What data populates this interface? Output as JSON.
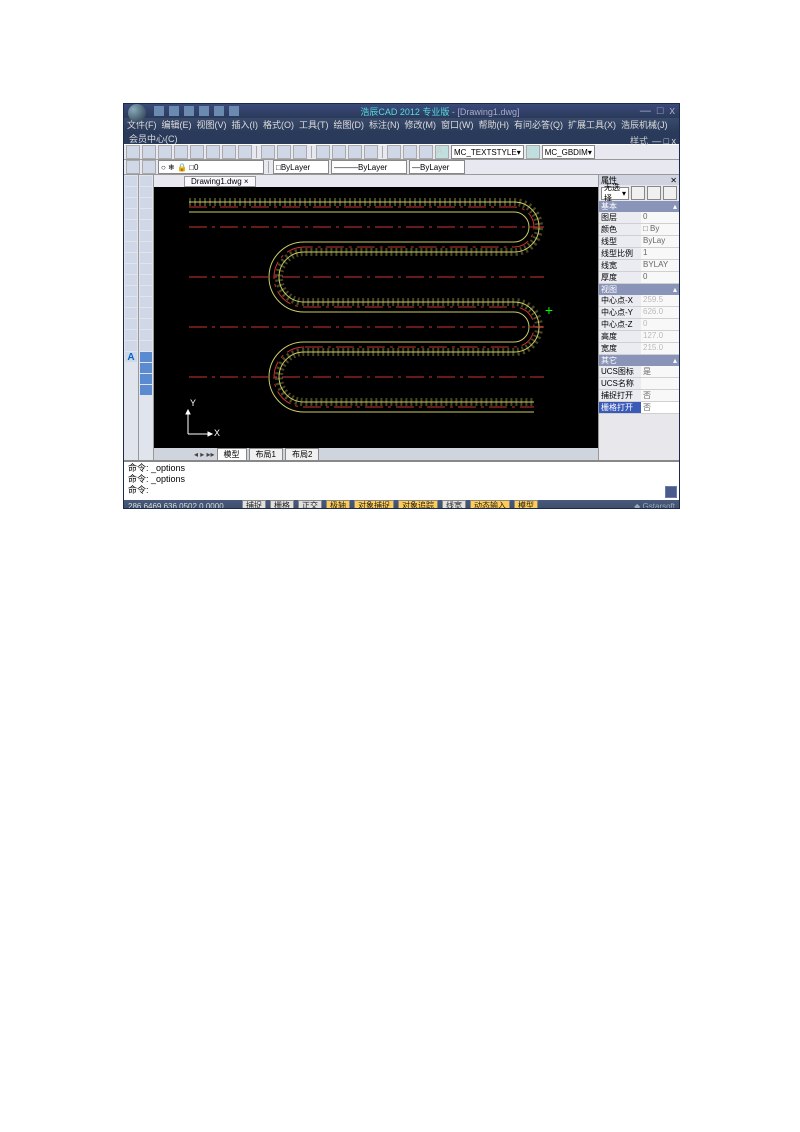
{
  "title": {
    "app": "浩辰CAD 2012 专业版",
    "doc": "[Drawing1.dwg]"
  },
  "win": {
    "min": "—",
    "max": "□",
    "close": "x"
  },
  "menus": [
    "文件(F)",
    "编辑(E)",
    "视图(V)",
    "插入(I)",
    "格式(O)",
    "工具(T)",
    "绘图(D)",
    "标注(N)",
    "修改(M)",
    "窗口(W)",
    "帮助(H)",
    "有问必答(Q)",
    "扩展工具(X)",
    "浩辰机械(J)"
  ],
  "menus2": {
    "member": "会员中心(C)",
    "style": "样式",
    "sub": "— □ x"
  },
  "styles": {
    "text": "MC_TEXTSTYLE",
    "dim": "MC_GBDIM"
  },
  "layer": {
    "name": "0",
    "color1": "ByLayer",
    "color2": "ByLayer",
    "color3": "ByLayer"
  },
  "doctab": "Drawing1.dwg ×",
  "viewtabs": {
    "model": "模型",
    "l1": "布局1",
    "l2": "布局2"
  },
  "cmd": {
    "l1": "命令: _options",
    "l2": "命令: _options",
    "l3": "命令:"
  },
  "status": {
    "coord": "286.6469,636.0502,0.0000",
    "btns": [
      "捕捉",
      "栅格",
      "正交",
      "极轴",
      "对象捕捉",
      "对象追踪",
      "线宽",
      "动态输入",
      "模型"
    ],
    "brand": "Gstarsoft"
  },
  "props": {
    "title": "属性",
    "sel": "无选择",
    "cats": {
      "basic": "基本",
      "view": "视图",
      "misc": "其它"
    },
    "rows": {
      "layer": {
        "l": "图层",
        "v": "0"
      },
      "color": {
        "l": "颜色",
        "v": "□ By"
      },
      "ltype": {
        "l": "线型",
        "v": "ByLay"
      },
      "lscale": {
        "l": "线型比例",
        "v": "1"
      },
      "lweight": {
        "l": "线宽",
        "v": "BYLAY"
      },
      "thick": {
        "l": "厚度",
        "v": "0"
      },
      "cx": {
        "l": "中心点-X",
        "v": "259.5"
      },
      "cy": {
        "l": "中心点-Y",
        "v": "626.0"
      },
      "cz": {
        "l": "中心点-Z",
        "v": "0"
      },
      "h": {
        "l": "高度",
        "v": "127.0"
      },
      "w": {
        "l": "宽度",
        "v": "215.0"
      },
      "ucs": {
        "l": "UCS图标打开",
        "v": "是"
      },
      "ucsn": {
        "l": "UCS名称",
        "v": ""
      },
      "snap": {
        "l": "捕捉打开",
        "v": "否"
      },
      "grid": {
        "l": "栅格打开",
        "v": "否"
      }
    }
  },
  "axes": {
    "x": "X",
    "y": "Y"
  }
}
